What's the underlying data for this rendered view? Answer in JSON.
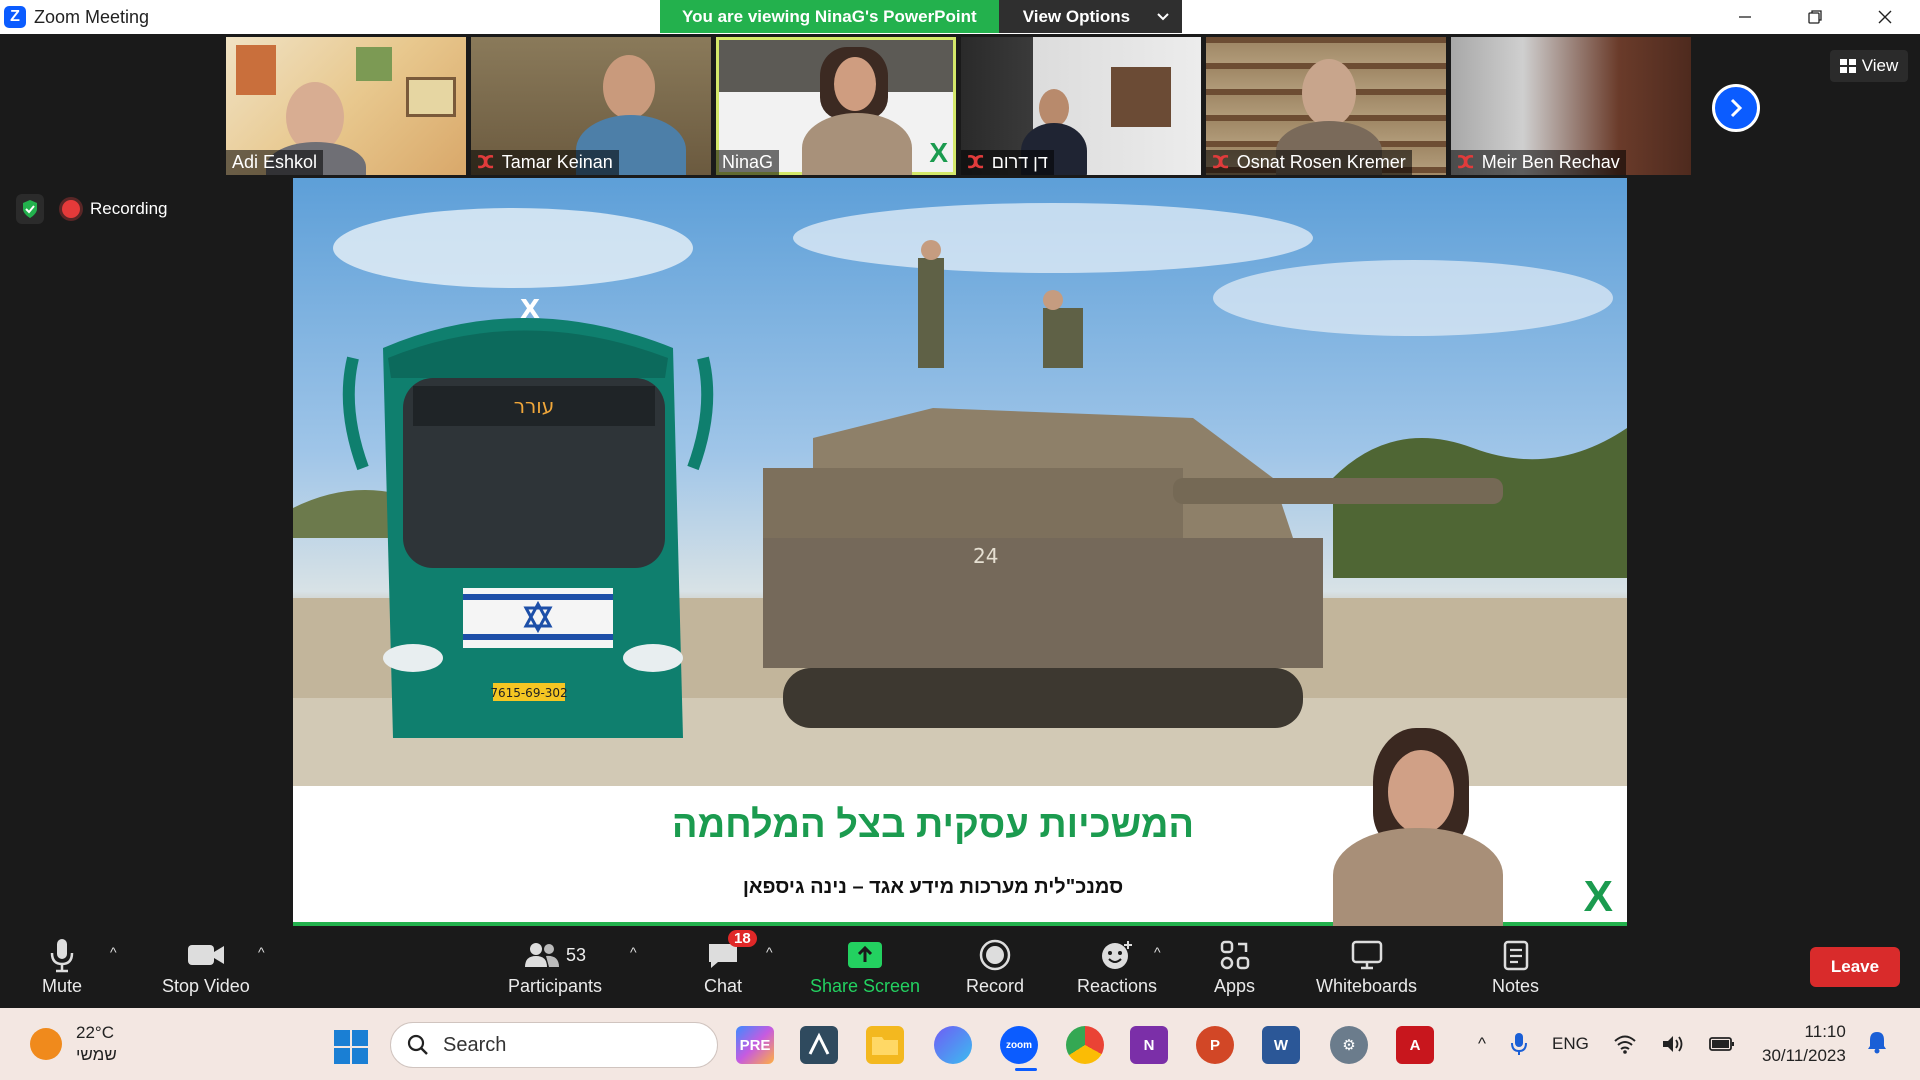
{
  "window": {
    "title": "Zoom Meeting",
    "viewing_banner": "You are viewing NinaG's PowerPoint",
    "view_options": "View Options"
  },
  "gallery": {
    "view_label": "View",
    "tiles": [
      {
        "name": "Adi Eshkol",
        "muted": false
      },
      {
        "name": "Tamar Keinan",
        "muted": true
      },
      {
        "name": "NinaG",
        "muted": false
      },
      {
        "name": "דן דרום",
        "muted": true
      },
      {
        "name": "Osnat Rosen Kremer",
        "muted": true
      },
      {
        "name": "Meir Ben Rechav",
        "muted": true
      }
    ]
  },
  "recording": {
    "label": "Recording"
  },
  "slide": {
    "title": "המשכיות עסקית בצל המלחמה",
    "subtitle": "סמנכ\"לית מערכות מידע אגד – נינה גיספאן",
    "plate": "7615-69-302",
    "tank_marking": "24"
  },
  "toolbar": {
    "mute": "Mute",
    "stop_video": "Stop Video",
    "participants": "Participants",
    "participants_count": "53",
    "chat": "Chat",
    "chat_badge": "18",
    "share_screen": "Share Screen",
    "record": "Record",
    "reactions": "Reactions",
    "apps": "Apps",
    "whiteboards": "Whiteboards",
    "notes": "Notes",
    "leave": "Leave"
  },
  "taskbar": {
    "temperature": "22°C",
    "weather_desc": "שמשי",
    "search_placeholder": "Search",
    "language": "ENG",
    "time": "11:10",
    "date": "30/11/2023"
  },
  "colors": {
    "zoom_blue": "#0b5cff",
    "banner_green": "#23b14d",
    "leave_red": "#d92b2b",
    "slide_green": "#1b9b4f"
  }
}
